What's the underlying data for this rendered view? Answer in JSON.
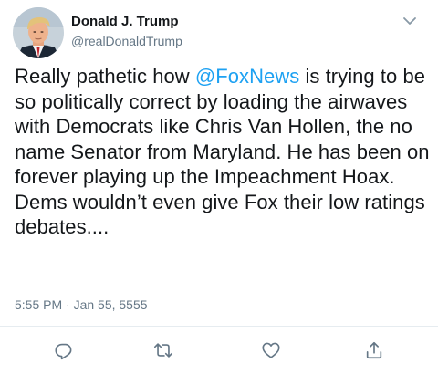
{
  "tweet": {
    "author": {
      "display_name": "Donald J. Trump",
      "handle": "@realDonaldTrump"
    },
    "text": {
      "before_mention": "Really pathetic how ",
      "mention": "@FoxNews",
      "after_mention": " is trying to be so politically correct by loading the airwaves with Democrats like Chris Van Hollen, the no name Senator from Maryland. He has been on forever playing up the Impeachment Hoax. Dems wouldn’t even give Fox their low ratings debates...."
    },
    "timestamp": "5:55 PM · Jan 55, 5555",
    "icons": {
      "menu": "chevron-down-icon",
      "reply": "reply-icon",
      "retweet": "retweet-icon",
      "like": "heart-icon",
      "share": "share-icon"
    },
    "colors": {
      "link": "#1da1f2",
      "secondary_text": "#657786",
      "icon": "#657786",
      "divider": "#e6ecf0"
    }
  }
}
